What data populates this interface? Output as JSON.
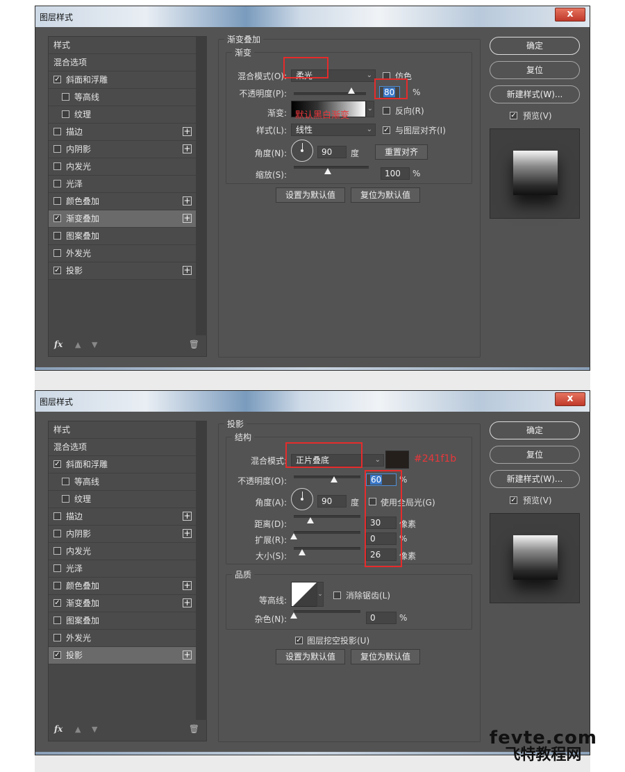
{
  "dialogs": [
    {
      "title": "图层样式",
      "close_label": "x",
      "sidebar": [
        {
          "label": "样式",
          "checkbox": false,
          "checked": false,
          "plus": false,
          "indent": false,
          "selected": false
        },
        {
          "label": "混合选项",
          "checkbox": false,
          "checked": false,
          "plus": false,
          "indent": false,
          "selected": false
        },
        {
          "label": "斜面和浮雕",
          "checkbox": true,
          "checked": true,
          "plus": false,
          "indent": false,
          "selected": false
        },
        {
          "label": "等高线",
          "checkbox": true,
          "checked": false,
          "plus": false,
          "indent": true,
          "selected": false
        },
        {
          "label": "纹理",
          "checkbox": true,
          "checked": false,
          "plus": false,
          "indent": true,
          "selected": false
        },
        {
          "label": "描边",
          "checkbox": true,
          "checked": false,
          "plus": true,
          "indent": false,
          "selected": false
        },
        {
          "label": "内阴影",
          "checkbox": true,
          "checked": false,
          "plus": true,
          "indent": false,
          "selected": false
        },
        {
          "label": "内发光",
          "checkbox": true,
          "checked": false,
          "plus": false,
          "indent": false,
          "selected": false
        },
        {
          "label": "光泽",
          "checkbox": true,
          "checked": false,
          "plus": false,
          "indent": false,
          "selected": false
        },
        {
          "label": "颜色叠加",
          "checkbox": true,
          "checked": false,
          "plus": true,
          "indent": false,
          "selected": false
        },
        {
          "label": "渐变叠加",
          "checkbox": true,
          "checked": true,
          "plus": true,
          "indent": false,
          "selected": true
        },
        {
          "label": "图案叠加",
          "checkbox": true,
          "checked": false,
          "plus": false,
          "indent": false,
          "selected": false
        },
        {
          "label": "外发光",
          "checkbox": true,
          "checked": false,
          "plus": false,
          "indent": false,
          "selected": false
        },
        {
          "label": "投影",
          "checkbox": true,
          "checked": true,
          "plus": true,
          "indent": false,
          "selected": false
        }
      ],
      "footer": {
        "fx": "fx",
        "up_icon": "arrow-up-icon",
        "down_icon": "arrow-down-icon",
        "trash_icon": "trash-icon"
      },
      "panel": {
        "group_title": "渐变叠加",
        "section_title": "渐变",
        "blend_label": "混合模式(O):",
        "blend_value": "柔光",
        "dither_label": "仿色",
        "dither_checked": false,
        "opacity_label": "不透明度(P):",
        "opacity_value": "80",
        "opacity_unit": "%",
        "opacity_fraction": 0.8,
        "gradient_label": "渐变:",
        "gradient_note": "默认黑白渐变",
        "reverse_label": "反向(R)",
        "reverse_checked": false,
        "style_label": "样式(L):",
        "style_value": "线性",
        "align_label": "与图层对齐(I)",
        "align_checked": true,
        "angle_label": "角度(N):",
        "angle_value": "90",
        "angle_unit": "度",
        "reset_align_label": "重置对齐",
        "scale_label": "缩放(S):",
        "scale_value": "100",
        "scale_unit": "%",
        "scale_fraction": 0.45,
        "default_btn": "设置为默认值",
        "reset_default_btn": "复位为默认值"
      },
      "right": {
        "ok": "确定",
        "reset": "复位",
        "new_style": "新建样式(W)...",
        "preview_label": "预览(V)",
        "preview_checked": true
      }
    },
    {
      "title": "图层样式",
      "close_label": "x",
      "sidebar": [
        {
          "label": "样式",
          "checkbox": false,
          "checked": false,
          "plus": false,
          "indent": false,
          "selected": false
        },
        {
          "label": "混合选项",
          "checkbox": false,
          "checked": false,
          "plus": false,
          "indent": false,
          "selected": false
        },
        {
          "label": "斜面和浮雕",
          "checkbox": true,
          "checked": true,
          "plus": false,
          "indent": false,
          "selected": false
        },
        {
          "label": "等高线",
          "checkbox": true,
          "checked": false,
          "plus": false,
          "indent": true,
          "selected": false
        },
        {
          "label": "纹理",
          "checkbox": true,
          "checked": false,
          "plus": false,
          "indent": true,
          "selected": false
        },
        {
          "label": "描边",
          "checkbox": true,
          "checked": false,
          "plus": true,
          "indent": false,
          "selected": false
        },
        {
          "label": "内阴影",
          "checkbox": true,
          "checked": false,
          "plus": true,
          "indent": false,
          "selected": false
        },
        {
          "label": "内发光",
          "checkbox": true,
          "checked": false,
          "plus": false,
          "indent": false,
          "selected": false
        },
        {
          "label": "光泽",
          "checkbox": true,
          "checked": false,
          "plus": false,
          "indent": false,
          "selected": false
        },
        {
          "label": "颜色叠加",
          "checkbox": true,
          "checked": false,
          "plus": true,
          "indent": false,
          "selected": false
        },
        {
          "label": "渐变叠加",
          "checkbox": true,
          "checked": true,
          "plus": true,
          "indent": false,
          "selected": false
        },
        {
          "label": "图案叠加",
          "checkbox": true,
          "checked": false,
          "plus": false,
          "indent": false,
          "selected": false
        },
        {
          "label": "外发光",
          "checkbox": true,
          "checked": false,
          "plus": false,
          "indent": false,
          "selected": false
        },
        {
          "label": "投影",
          "checkbox": true,
          "checked": true,
          "plus": true,
          "indent": false,
          "selected": true
        }
      ],
      "footer": {
        "fx": "fx",
        "up_icon": "arrow-up-icon",
        "down_icon": "arrow-down-icon",
        "trash_icon": "trash-icon"
      },
      "panel": {
        "group_title": "投影",
        "structure_title": "结构",
        "blend_label": "混合模式:",
        "blend_value": "正片叠底",
        "shadow_color": "#241f1b",
        "shadow_color_note": "#241f1b",
        "opacity_label": "不透明度(O):",
        "opacity_value": "60",
        "opacity_unit": "%",
        "opacity_fraction": 0.6,
        "angle_label": "角度(A):",
        "angle_value": "90",
        "angle_unit": "度",
        "global_light_label": "使用全局光(G)",
        "global_light_checked": false,
        "distance_label": "距离(D):",
        "distance_value": "30",
        "distance_unit": "像素",
        "distance_fraction": 0.25,
        "spread_label": "扩展(R):",
        "spread_value": "0",
        "spread_unit": "%",
        "spread_fraction": 0.0,
        "size_label": "大小(S):",
        "size_value": "26",
        "size_unit": "像素",
        "size_fraction": 0.12,
        "quality_title": "品质",
        "contour_label": "等高线:",
        "antialias_label": "消除锯齿(L)",
        "antialias_checked": false,
        "noise_label": "杂色(N):",
        "noise_value": "0",
        "noise_unit": "%",
        "noise_fraction": 0.0,
        "knockout_label": "图层挖空投影(U)",
        "knockout_checked": true,
        "default_btn": "设置为默认值",
        "reset_default_btn": "复位为默认值"
      },
      "right": {
        "ok": "确定",
        "reset": "复位",
        "new_style": "新建样式(W)...",
        "preview_label": "预览(V)",
        "preview_checked": true
      }
    }
  ],
  "watermark": {
    "line1": "fevte.com",
    "line2": "飞特教程网"
  },
  "colors": {
    "panel_bg": "#535353",
    "highlight_red": "#e62b2b",
    "selection_blue": "#3a78c8"
  }
}
